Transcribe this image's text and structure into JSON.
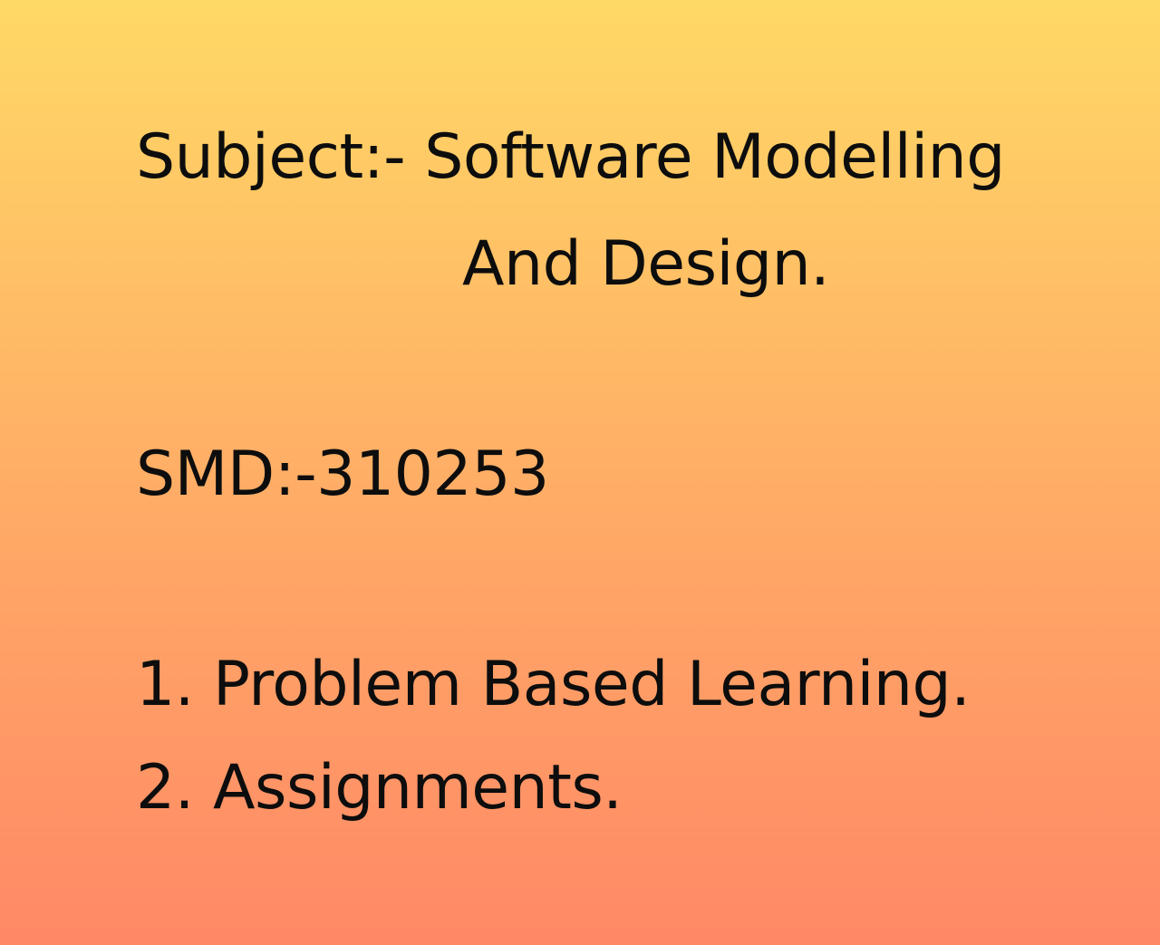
{
  "subject": {
    "line1": "Subject:- Software Modelling",
    "line2": "And Design."
  },
  "code": "SMD:-310253",
  "items": [
    "1. Problem Based Learning.",
    "2. Assignments."
  ],
  "colors": {
    "gradient_top": "#ffd966",
    "gradient_bottom": "#ff8866",
    "text": "#0d0d0d"
  }
}
